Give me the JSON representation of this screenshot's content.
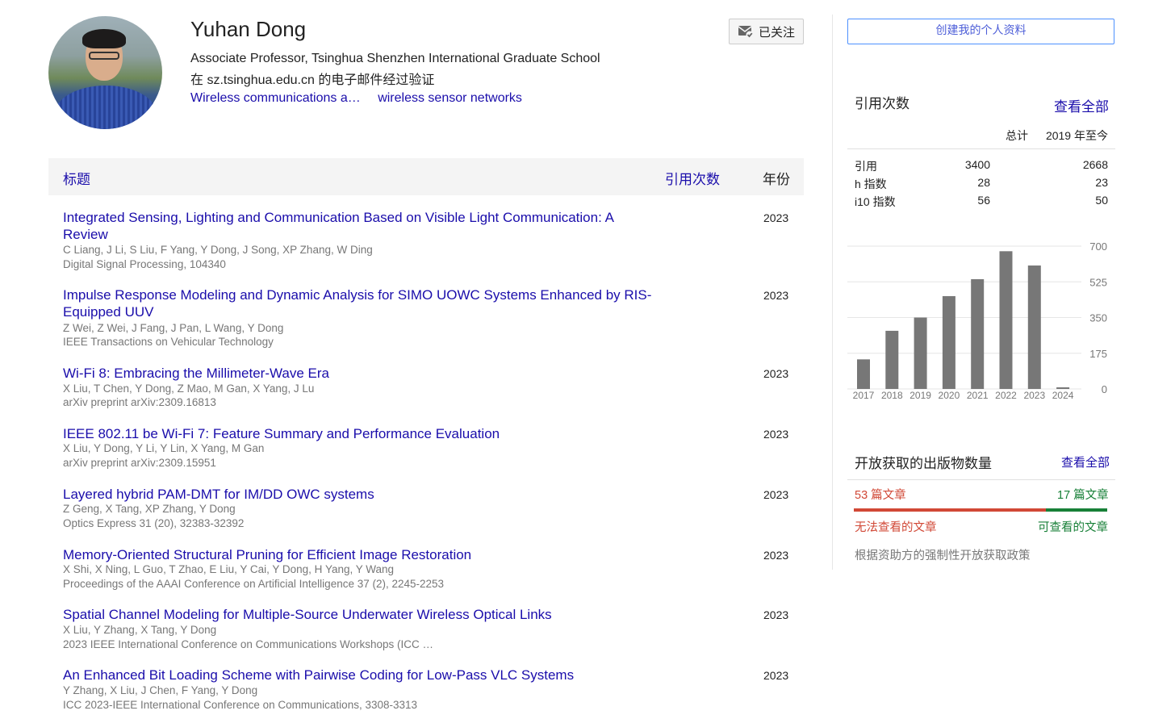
{
  "profile": {
    "name": "Yuhan Dong",
    "affiliation": "Associate Professor, Tsinghua Shenzhen International Graduate School",
    "verified": "在 sz.tsinghua.edu.cn 的电子邮件经过验证",
    "interests": [
      "Wireless communications a…",
      "wireless sensor networks"
    ],
    "follow_label": "已关注"
  },
  "table": {
    "headers": {
      "title": "标题",
      "cited": "引用次数",
      "year": "年份"
    },
    "articles": [
      {
        "title": "Integrated Sensing, Lighting and Communication Based on Visible Light Communication: A Review",
        "authors": "C Liang, J Li, S Liu, F Yang, Y Dong, J Song, XP Zhang, W Ding",
        "venue": "Digital Signal Processing, 104340",
        "year": "2023"
      },
      {
        "title": "Impulse Response Modeling and Dynamic Analysis for SIMO UOWC Systems Enhanced by RIS-Equipped UUV",
        "authors": "Z Wei, Z Wei, J Fang, J Pan, L Wang, Y Dong",
        "venue": "IEEE Transactions on Vehicular Technology",
        "year": "2023"
      },
      {
        "title": "Wi-Fi 8: Embracing the Millimeter-Wave Era",
        "authors": "X Liu, T Chen, Y Dong, Z Mao, M Gan, X Yang, J Lu",
        "venue": "arXiv preprint arXiv:2309.16813",
        "year": "2023"
      },
      {
        "title": "IEEE 802.11 be Wi-Fi 7: Feature Summary and Performance Evaluation",
        "authors": "X Liu, Y Dong, Y Li, Y Lin, X Yang, M Gan",
        "venue": "arXiv preprint arXiv:2309.15951",
        "year": "2023"
      },
      {
        "title": "Layered hybrid PAM-DMT for IM/DD OWC systems",
        "authors": "Z Geng, X Tang, XP Zhang, Y Dong",
        "venue": "Optics Express 31 (20), 32383-32392",
        "year": "2023"
      },
      {
        "title": "Memory-Oriented Structural Pruning for Efficient Image Restoration",
        "authors": "X Shi, X Ning, L Guo, T Zhao, E Liu, Y Cai, Y Dong, H Yang, Y Wang",
        "venue": "Proceedings of the AAAI Conference on Artificial Intelligence 37 (2), 2245-2253",
        "year": "2023"
      },
      {
        "title": "Spatial Channel Modeling for Multiple-Source Underwater Wireless Optical Links",
        "authors": "X Liu, Y Zhang, X Tang, Y Dong",
        "venue": "2023 IEEE International Conference on Communications Workshops (ICC …",
        "year": "2023"
      },
      {
        "title": "An Enhanced Bit Loading Scheme with Pairwise Coding for Low-Pass VLC Systems",
        "authors": "Y Zhang, X Liu, J Chen, F Yang, Y Dong",
        "venue": "ICC 2023-IEEE International Conference on Communications, 3308-3313",
        "year": "2023"
      }
    ]
  },
  "sidebar": {
    "create_profile": "创建我的个人资料",
    "citations": {
      "heading": "引用次数",
      "view_all": "查看全部",
      "col_total": "总计",
      "col_since": "2019 年至今",
      "rows": [
        {
          "label": "引用",
          "total": "3400",
          "since": "2668"
        },
        {
          "label": "h 指数",
          "total": "28",
          "since": "23"
        },
        {
          "label": "i10 指数",
          "total": "56",
          "since": "50"
        }
      ]
    },
    "open_access": {
      "heading": "开放获取的出版物数量",
      "view_all": "查看全部",
      "unavailable_count": "53 篇文章",
      "available_count": "17 篇文章",
      "unavailable_label": "无法查看的文章",
      "available_label": "可查看的文章",
      "note": "根据资助方的强制性开放获取政策",
      "available_fraction": 0.243,
      "colors": {
        "unavailable": "#d14836",
        "available": "#188038"
      }
    }
  },
  "chart_data": {
    "type": "bar",
    "categories": [
      "2017",
      "2018",
      "2019",
      "2020",
      "2021",
      "2022",
      "2023",
      "2024"
    ],
    "values": [
      145,
      285,
      350,
      455,
      538,
      675,
      605,
      8
    ],
    "ylim": [
      0,
      700
    ],
    "yticks": [
      "0",
      "175",
      "350",
      "525",
      "700"
    ],
    "bar_color": "#777777",
    "grid": true
  }
}
